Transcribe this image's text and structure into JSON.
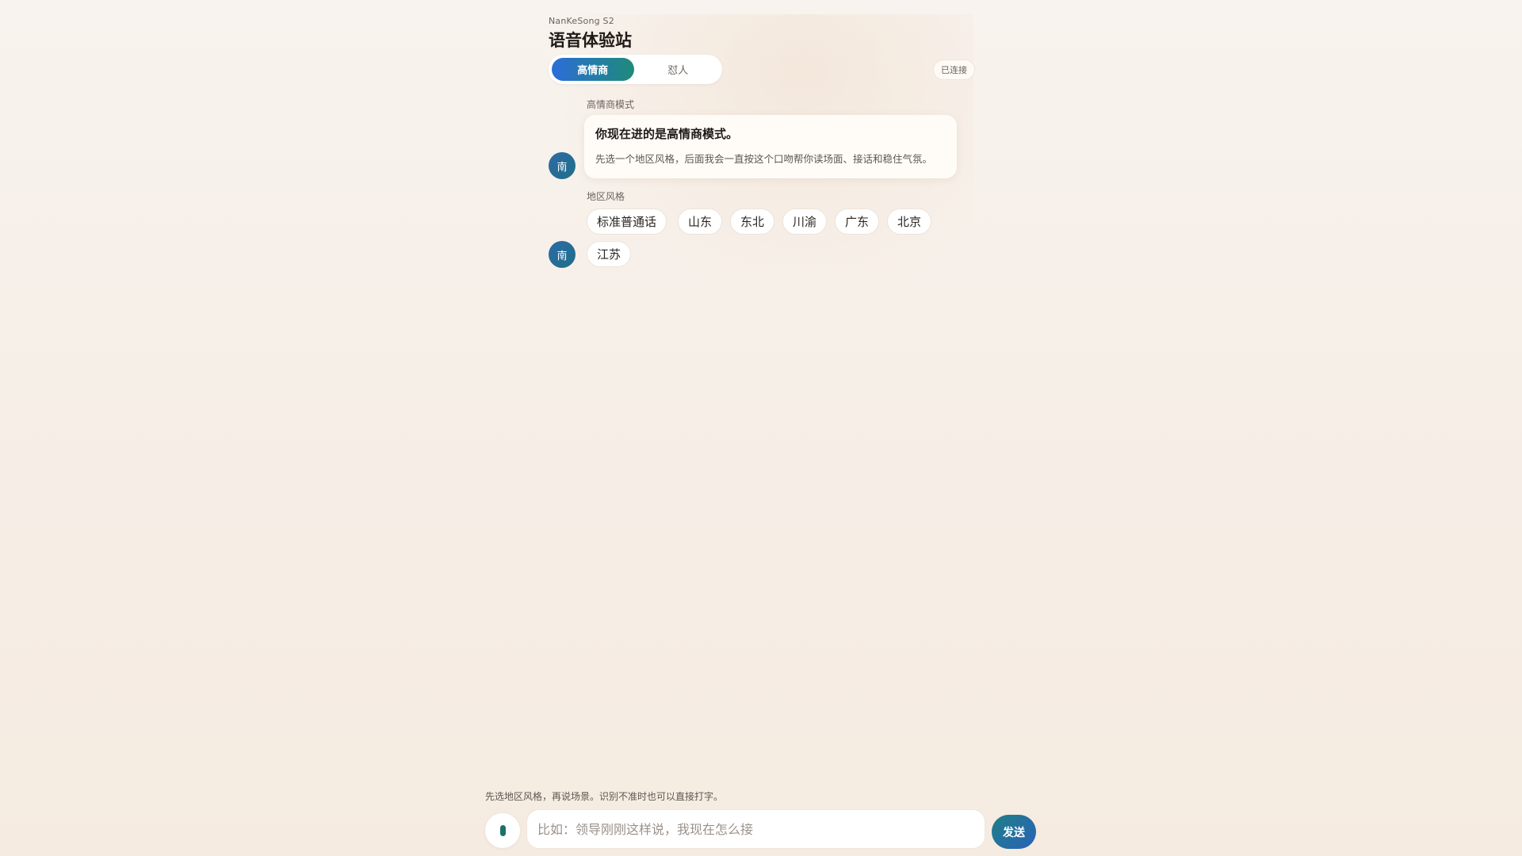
{
  "header": {
    "brand": "NanKeSong S2",
    "title": "语音体验站"
  },
  "modes": {
    "active": "高情商",
    "inactive": "怼人"
  },
  "status": {
    "connection": "已连接"
  },
  "assistant": {
    "avatar_char": "南"
  },
  "mode_section": {
    "label": "高情商模式",
    "card_title": "你现在进的是高情商模式。",
    "card_body": "先选一个地区风格，后面我会一直按这个口吻帮你读场面、接话和稳住气氛。"
  },
  "region_section": {
    "label": "地区风格",
    "options": [
      "标准普通话",
      "山东",
      "东北",
      "川渝",
      "广东",
      "北京",
      "江苏"
    ]
  },
  "footer": {
    "hint": "先选地区风格，再说场景。识别不准时也可以直接打字。",
    "input_placeholder": "比如：领导刚刚这样说，我现在怎么接",
    "input_value": "",
    "send_label": "发送",
    "mic_icon": "mic-icon"
  },
  "colors": {
    "accent_start": "#2b6dd8",
    "accent_end": "#1f8a7a",
    "avatar": "#2d6aa8",
    "background": "#f8f3ee"
  }
}
